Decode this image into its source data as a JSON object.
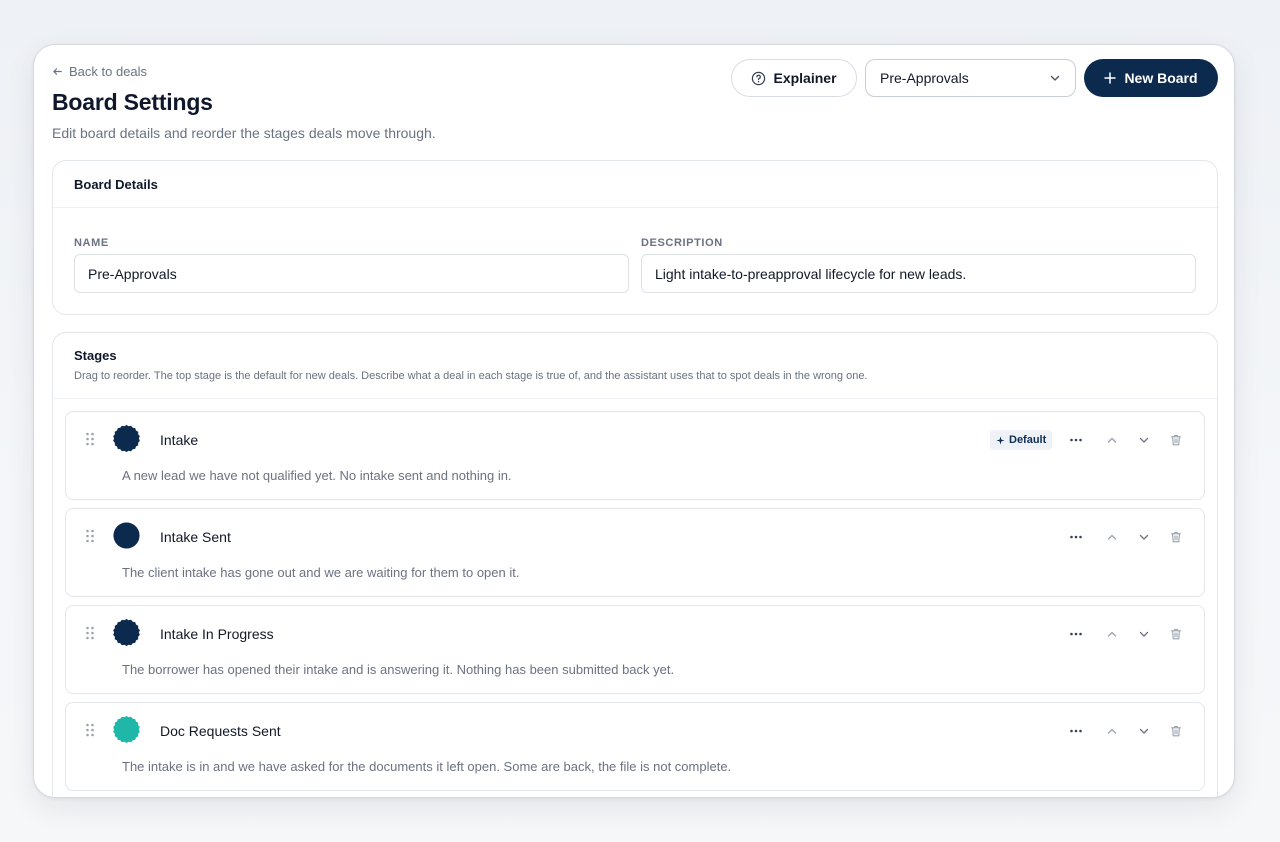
{
  "header": {
    "back_label": "Back to deals",
    "title": "Board Settings",
    "subtitle": "Edit board details and reorder the stages deals move through.",
    "explainer_label": "Explainer",
    "board_select_value": "Pre-Approvals",
    "new_board_label": "New Board"
  },
  "details": {
    "title": "Board Details",
    "name_label": "NAME",
    "name_value": "Pre-Approvals",
    "description_label": "DESCRIPTION",
    "description_value": "Light intake-to-preapproval lifecycle for new leads."
  },
  "stages": {
    "title": "Stages",
    "hint": "Drag to reorder. The top stage is the default for new deals. Describe what a deal in each stage is true of, and the assistant uses that to spot deals in the wrong one.",
    "default_badge": "Default",
    "items": [
      {
        "name": "Intake",
        "description": "A new lead we have not qualified yet. No intake sent and nothing in.",
        "color": "#0c2a4d",
        "is_default": true
      },
      {
        "name": "Intake Sent",
        "description": "The client intake has gone out and we are waiting for them to open it.",
        "color": "#0c2a4d",
        "is_default": false
      },
      {
        "name": "Intake In Progress",
        "description": "The borrower has opened their intake and is answering it. Nothing has been submitted back yet.",
        "color": "#0c2a4d",
        "is_default": false
      },
      {
        "name": "Doc Requests Sent",
        "description": "The intake is in and we have asked for the documents it left open. Some are back, the file is not complete.",
        "color": "#1fb8a8",
        "is_default": false
      }
    ]
  },
  "colors": {
    "primary": "#0c2a4d",
    "teal": "#1fb8a8",
    "muted_text": "#6b7280"
  },
  "icons": [
    "arrow-left-icon",
    "help-circle-icon",
    "chevron-down-icon",
    "plus-icon",
    "drag-handle-icon",
    "sparkle-icon",
    "more-icon",
    "chevron-up-icon",
    "trash-icon"
  ]
}
